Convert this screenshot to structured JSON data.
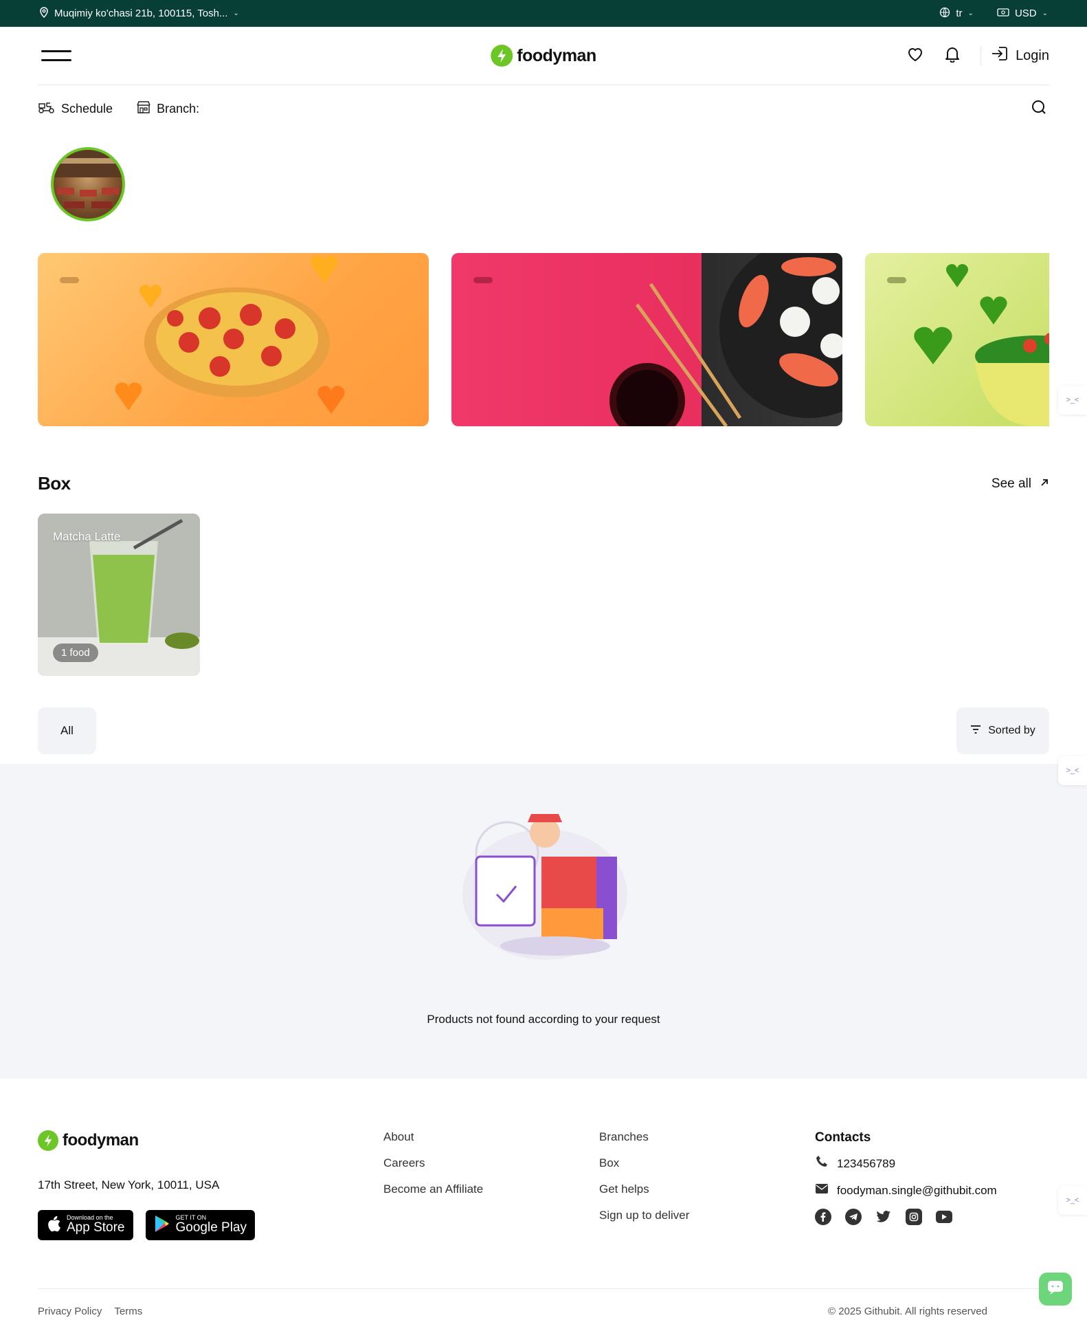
{
  "topbar": {
    "address": "Muqimiy ko'chasi 21b, 100115, Tosh...",
    "language": "tr",
    "currency": "USD"
  },
  "header": {
    "brand": "foodyman",
    "login_label": "Login"
  },
  "subbar": {
    "schedule_label": "Schedule",
    "branch_label": "Branch:"
  },
  "banners": [
    {
      "name": "pizza",
      "accent": "#ffa445"
    },
    {
      "name": "sushi",
      "accent": "#e82f5e"
    },
    {
      "name": "salad",
      "accent": "#c9e06a"
    }
  ],
  "box_section": {
    "title": "Box",
    "see_all": "See all",
    "cards": [
      {
        "title": "Matcha Latte",
        "count": "1 food"
      }
    ]
  },
  "filters": {
    "all_label": "All",
    "sort_label": "Sorted by"
  },
  "empty_state": {
    "message": "Products not found according to your request"
  },
  "footer": {
    "brand": "foodyman",
    "address": "17th Street, New York, 10011, USA",
    "app_store": {
      "small": "Download on the",
      "big": "App Store"
    },
    "google_play": {
      "small": "GET IT ON",
      "big": "Google Play"
    },
    "col1": [
      "About",
      "Careers",
      "Become an Affiliate"
    ],
    "col2": [
      "Branches",
      "Box",
      "Get helps",
      "Sign up to deliver"
    ],
    "contacts_title": "Contacts",
    "phone": "123456789",
    "email": "foodyman.single@githubit.com",
    "socials": [
      "facebook-icon",
      "telegram-icon",
      "twitter-icon",
      "instagram-icon",
      "youtube-icon"
    ],
    "privacy": "Privacy Policy",
    "terms": "Terms",
    "copyright": "© 2025 Githubit. All rights reserved"
  },
  "colors": {
    "topbar": "#073e36",
    "brand_green": "#6cc625",
    "chat_button": "#6dd67a"
  }
}
